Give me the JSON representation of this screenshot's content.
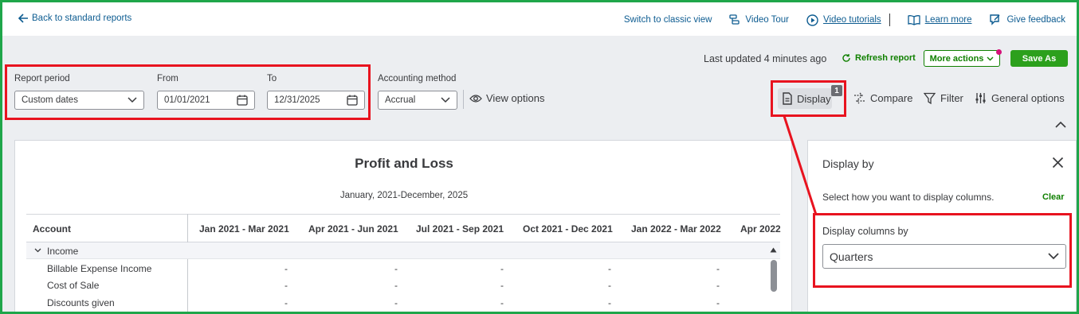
{
  "nav": {
    "back_label": "Back to standard reports",
    "switch_label": "Switch to classic view",
    "video_tour_label": "Video Tour",
    "video_tutorials_label": "Video tutorials",
    "learn_more_label": "Learn more",
    "give_feedback_label": "Give feedback"
  },
  "actions": {
    "last_updated": "Last updated 4 minutes ago",
    "refresh_label": "Refresh report",
    "more_actions_label": "More actions",
    "save_as_label": "Save As"
  },
  "filters": {
    "report_period_label": "Report period",
    "report_period_value": "Custom dates",
    "from_label": "From",
    "from_value": "01/01/2021",
    "to_label": "To",
    "to_value": "12/31/2025",
    "accounting_method_label": "Accounting method",
    "accounting_method_value": "Accrual",
    "view_options_label": "View options"
  },
  "tools": {
    "display_label": "Display",
    "display_badge": "1",
    "compare_label": "Compare",
    "filter_label": "Filter",
    "general_options_label": "General options"
  },
  "report": {
    "title": "Profit and Loss",
    "subtitle": "January, 2021-December, 2025",
    "columns": [
      "Account",
      "Jan 2021 - Mar 2021",
      "Apr 2021 - Jun 2021",
      "Jul 2021 - Sep 2021",
      "Oct 2021 - Dec 2021",
      "Jan 2022 - Mar 2022",
      "Apr 2022"
    ],
    "section": "Income",
    "rows": [
      {
        "account": "Billable Expense Income",
        "values": [
          "-",
          "-",
          "-",
          "-",
          "-",
          "-"
        ]
      },
      {
        "account": "Cost of Sale",
        "values": [
          "-",
          "-",
          "-",
          "-",
          "-",
          "-"
        ]
      },
      {
        "account": "Discounts given",
        "values": [
          "-",
          "-",
          "-",
          "-",
          "-",
          "-"
        ]
      }
    ]
  },
  "display_panel": {
    "title": "Display by",
    "description": "Select how you want to display columns.",
    "clear_label": "Clear",
    "columns_by_label": "Display columns by",
    "columns_by_value": "Quarters"
  },
  "colors": {
    "accent_green": "#2ca01c",
    "link_blue": "#0d5c91",
    "highlight_red": "#e8131f",
    "frame_green": "#1fa64a"
  }
}
